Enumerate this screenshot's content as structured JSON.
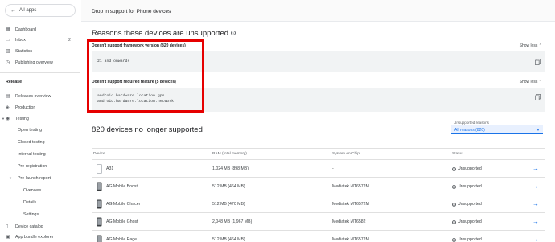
{
  "sidebar": {
    "all_apps": "All apps",
    "items": [
      {
        "label": "Dashboard",
        "icon": "dashboard-icon"
      },
      {
        "label": "Inbox",
        "icon": "inbox-icon",
        "count": "2"
      },
      {
        "label": "Statistics",
        "icon": "statistics-icon"
      },
      {
        "label": "Publishing overview",
        "icon": "publishing-icon"
      }
    ],
    "release_section": "Release",
    "release_items": [
      {
        "label": "Releases overview",
        "icon": "releases-icon"
      },
      {
        "label": "Production",
        "icon": "production-icon"
      },
      {
        "label": "Testing",
        "icon": "testing-icon"
      },
      {
        "label": "Open testing"
      },
      {
        "label": "Closed testing"
      },
      {
        "label": "Internal testing"
      },
      {
        "label": "Pre-registration"
      },
      {
        "label": "Pre-launch report"
      },
      {
        "label": "Overview"
      },
      {
        "label": "Details"
      },
      {
        "label": "Settings"
      },
      {
        "label": "Device catalog",
        "icon": "device-catalog-icon"
      },
      {
        "label": "App bundle explorer",
        "icon": "bundle-icon"
      }
    ]
  },
  "main": {
    "top_text": "Drop in support for Phone devices",
    "reasons_title": "Reasons these devices are unsupported",
    "reason1": {
      "title": "Doesn't support framework version (820 devices)",
      "toggle": "Show less",
      "code": [
        "21 and onwards"
      ]
    },
    "reason2": {
      "title": "Doesn't support required feature (5 devices)",
      "toggle": "Show less",
      "code": [
        "android.hardware.location.gps",
        "android.hardware.location.network"
      ]
    },
    "devices_count": "820",
    "devices_title_rest": " devices no longer supported",
    "filter_label": "Unsupported reasons",
    "filter_value": "All reasons (820)",
    "table": {
      "headers": [
        "Device",
        "RAM (total memory)",
        "System on Chip",
        "Status"
      ],
      "rows": [
        {
          "device": "A31",
          "ram": "1,024 MB (898 MB)",
          "soc": "-",
          "status": "Unsupported"
        },
        {
          "device": "AG Mobile Boost",
          "ram": "512 MB (464 MB)",
          "soc": "Mediatek MT6572M",
          "status": "Unsupported"
        },
        {
          "device": "AG Mobile Chacer",
          "ram": "512 MB (470 MB)",
          "soc": "Mediatek MT6572M",
          "status": "Unsupported"
        },
        {
          "device": "AG Mobile Ghost",
          "ram": "2,048 MB (1,967 MB)",
          "soc": "Mediatek MT6582",
          "status": "Unsupported"
        },
        {
          "device": "AG Mobile Rage",
          "ram": "512 MB (464 MB)",
          "soc": "Mediatek MT6572M",
          "status": "Unsupported"
        }
      ]
    }
  },
  "colors": {
    "accent": "#1a73e8",
    "highlight": "#e60000"
  }
}
